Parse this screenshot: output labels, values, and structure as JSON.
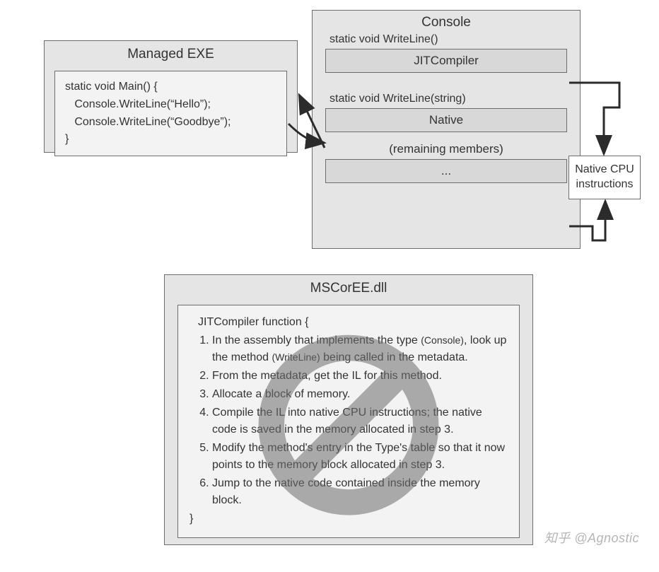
{
  "managed_exe": {
    "title": "Managed EXE",
    "code_lines": [
      "static void Main() {",
      "   Console.WriteLine(“Hello”);",
      "   Console.WriteLine(“Goodbye”);",
      "}"
    ]
  },
  "console": {
    "title": "Console",
    "method1_sig": "static void WriteLine()",
    "method1_box": "JITCompiler",
    "method2_sig": "static void WriteLine(string)",
    "method2_box": "Native",
    "remaining_label": "(remaining members)",
    "remaining_box": "..."
  },
  "native_cpu": {
    "label": "Native CPU instructions"
  },
  "mscoree": {
    "title": "MSCorEE.dll",
    "header": "JITCompiler function {",
    "steps": [
      "In the assembly that implements the type (Console), look up the method (WriteLine) being called in the metadata.",
      "From the metadata, get the IL for this method.",
      "Allocate a block of memory.",
      "Compile the IL into native CPU instructions; the native code is saved in the memory allocated in step 3.",
      "Modify the method's entry in the Type's table so that it now points to the memory block allocated in step 3.",
      "Jump to the native code contained inside the memory block."
    ],
    "footer": "}"
  },
  "watermark": "知乎 @Agnostic"
}
